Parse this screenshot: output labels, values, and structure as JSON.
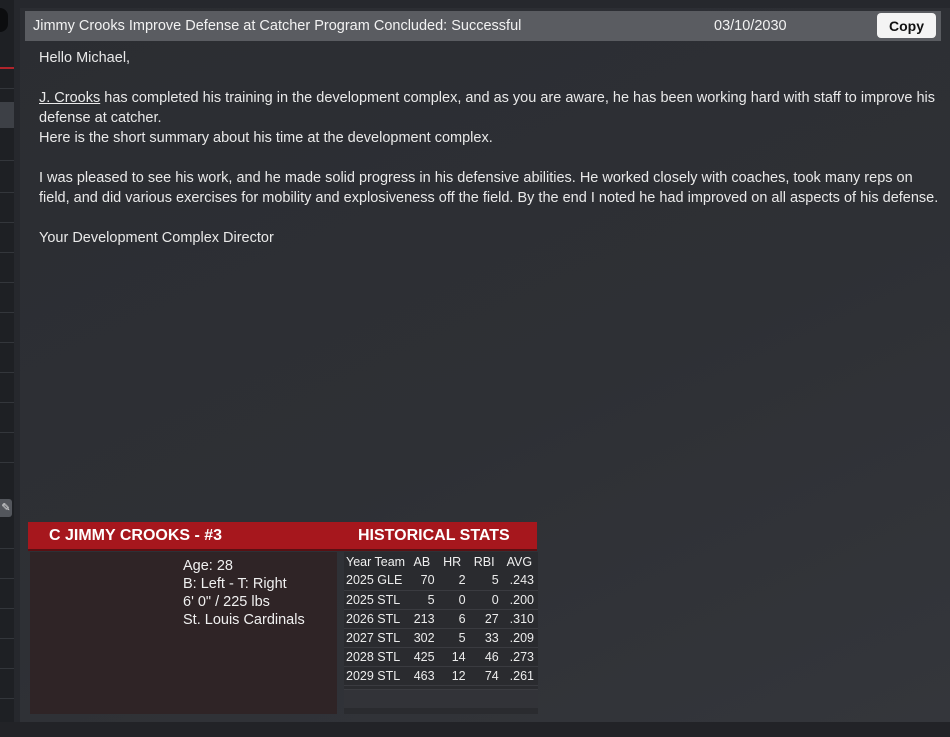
{
  "message": {
    "subject": "Jimmy Crooks Improve Defense at Catcher Program Concluded: Successful",
    "date": "03/10/2030",
    "copy_label": "Copy",
    "greeting": "Hello Michael,",
    "player_link": "J. Crooks",
    "para1_rest": " has completed his training in the development complex, and as you are aware, he has been working hard with staff to improve his defense at catcher.",
    "para1_line2": "Here is the short summary about his time at the development complex.",
    "para2": "I was pleased to see his work, and he made solid progress in his defensive abilities. He worked closely with coaches, took many reps on field, and did various exercises for mobility and explosiveness off the field. By the end I noted he had improved on all aspects of his defense.",
    "signature": "Your Development Complex Director"
  },
  "player_card": {
    "title": "C JIMMY CROOKS - #3",
    "stats_title": "HISTORICAL STATS",
    "age": "Age: 28",
    "bats_throws": "B: Left - T: Right",
    "height_weight": "6' 0\"  / 225 lbs",
    "team": "St. Louis Cardinals"
  },
  "historical_stats": {
    "headers": [
      "Year Team",
      "AB",
      "HR",
      "RBI",
      "AVG"
    ],
    "rows": [
      [
        "2025 GLE",
        "70",
        "2",
        "5",
        ".243"
      ],
      [
        "2025 STL",
        "5",
        "0",
        "0",
        ".200"
      ],
      [
        "2026 STL",
        "213",
        "6",
        "27",
        ".310"
      ],
      [
        "2027 STL",
        "302",
        "5",
        "33",
        ".209"
      ],
      [
        "2028 STL",
        "425",
        "14",
        "46",
        ".273"
      ],
      [
        "2029 STL",
        "463",
        "12",
        "74",
        ".261"
      ]
    ]
  },
  "colors": {
    "background": "#26282d",
    "header_bar": "#5a5c61",
    "card_red": "#a6171d"
  },
  "icons": {
    "edit": "pencil-icon"
  }
}
